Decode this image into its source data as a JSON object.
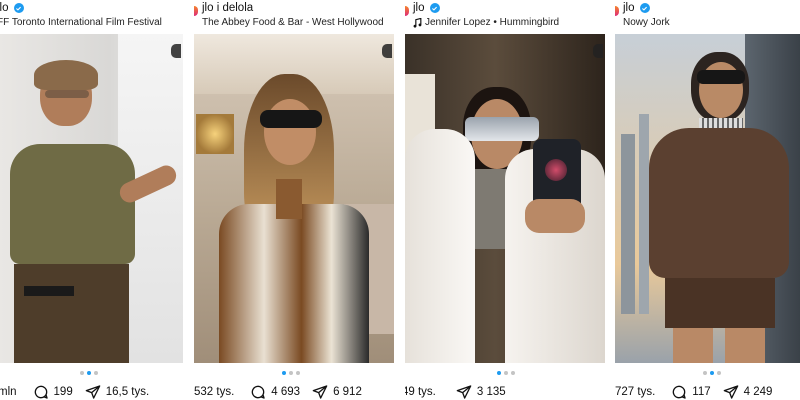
{
  "posts": [
    {
      "username": "jlo",
      "location": "FF Toronto International Film Festival",
      "likes": "mln",
      "comments": "199",
      "shares": "16,5 tys.",
      "carousel_dots": 3,
      "carousel_active": 2
    },
    {
      "username": "jlo i delola",
      "location": "The Abbey Food & Bar - West Hollywood",
      "likes": "532 tys.",
      "comments": "4 693",
      "shares": "6 912",
      "carousel_dots": 3,
      "carousel_active": 1
    },
    {
      "username": "jlo",
      "location": "Jennifer Lopez • Hummingbird",
      "likes": "49 tys.",
      "comments": "",
      "shares": "3 135",
      "carousel_dots": 3,
      "carousel_active": 1
    },
    {
      "username": "jlo",
      "location": "Nowy Jork",
      "likes": "727 tys.",
      "comments": "117",
      "shares": "4 249",
      "carousel_dots": 3,
      "carousel_active": 2
    }
  ],
  "icons": {
    "verified": "verified-badge-icon",
    "music": "music-note-icon",
    "comment": "comment-bubble-icon",
    "share": "paper-plane-share-icon"
  },
  "colors": {
    "verified": "#1d9bf0",
    "carousel_active": "#1d9bf0",
    "carousel_inactive": "#c4c4c4"
  }
}
